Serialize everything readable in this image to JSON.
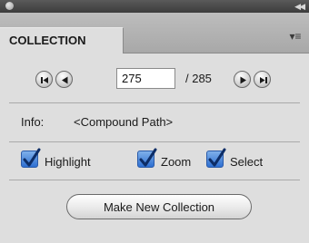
{
  "header": {
    "tab_label": "COLLECTION"
  },
  "icons": {
    "close": "close-dot-icon",
    "collapse": "double-chevron-icon",
    "menu": "panel-menu-icon",
    "first": "skip-first-icon",
    "previous": "step-back-icon",
    "next": "step-forward-icon",
    "last": "skip-last-icon"
  },
  "navigation": {
    "current_index": "275",
    "total_text": "/ 285"
  },
  "info": {
    "label": "Info:",
    "value": "<Compound Path>"
  },
  "options": [
    {
      "label": "Highlight",
      "checked": true
    },
    {
      "label": "Zoom",
      "checked": true
    },
    {
      "label": "Select",
      "checked": true
    }
  ],
  "actions": {
    "make_collection_label": "Make New Collection"
  },
  "colors": {
    "checkbox_accent": "#2e6fd1",
    "panel_bg": "#dedede"
  }
}
